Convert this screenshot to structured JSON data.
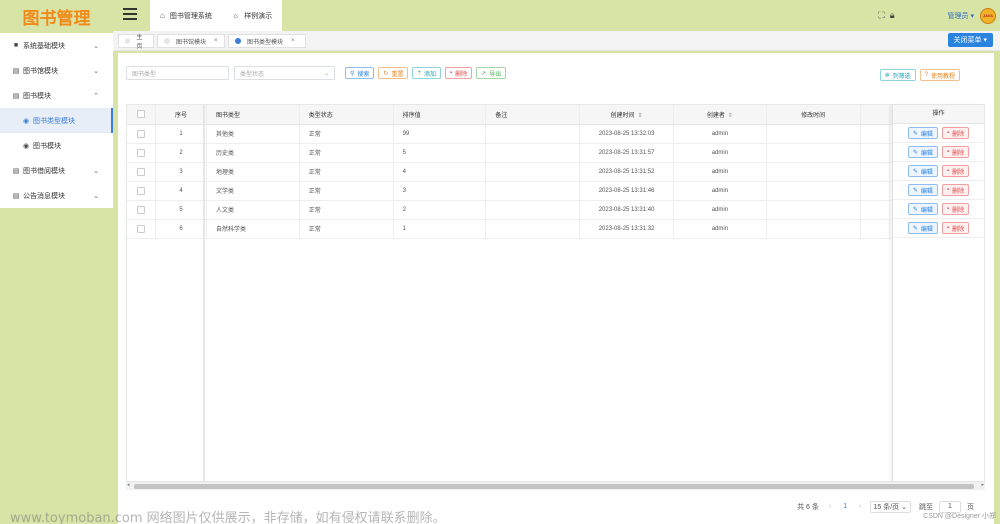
{
  "logo": "图书管理",
  "sidebar": {
    "items": [
      {
        "icon": "■",
        "label": "系统基础模块",
        "arrow": "⌄"
      },
      {
        "icon": "▤",
        "label": "图书馆模块",
        "arrow": "⌄"
      },
      {
        "icon": "▤",
        "label": "图书模块",
        "arrow": "⌃"
      },
      {
        "icon": "◉",
        "label": "图书类型模块",
        "arrow": ""
      },
      {
        "icon": "◉",
        "label": "图书模块",
        "arrow": ""
      },
      {
        "icon": "▤",
        "label": "图书借阅模块",
        "arrow": "⌄"
      },
      {
        "icon": "▤",
        "label": "公告消息模块",
        "arrow": "⌄"
      }
    ]
  },
  "header": {
    "tab_home": "图书管理系统",
    "tab_demo": "样例演示",
    "admin": "管理员",
    "avatar_text": "JAVA"
  },
  "tags": {
    "home": "主页",
    "tag1": "图书馆模块",
    "tag2": "图书类型模块",
    "close_menu": "关闭菜单"
  },
  "toolbar": {
    "type_placeholder": "图书类型",
    "status_placeholder": "类型状态",
    "search": "搜索",
    "reset": "重置",
    "add": "添加",
    "delete": "删除",
    "export": "导出",
    "filter_columns": "列筛选",
    "tutorial": "使用教程"
  },
  "table": {
    "headers": [
      "序号",
      "图书类型",
      "类型状态",
      "排序值",
      "备注",
      "创建时间",
      "创建者",
      "修改时间",
      "操作"
    ],
    "rows": [
      {
        "no": "1",
        "type": "其他类",
        "status": "正常",
        "sort": "99",
        "note": "",
        "created": "2023-08-25 13:32:03",
        "creator": "admin",
        "modified": ""
      },
      {
        "no": "2",
        "type": "历史类",
        "status": "正常",
        "sort": "5",
        "note": "",
        "created": "2023-08-25 13:31:57",
        "creator": "admin",
        "modified": ""
      },
      {
        "no": "3",
        "type": "地理类",
        "status": "正常",
        "sort": "4",
        "note": "",
        "created": "2023-08-25 13:31:52",
        "creator": "admin",
        "modified": ""
      },
      {
        "no": "4",
        "type": "文学类",
        "status": "正常",
        "sort": "3",
        "note": "",
        "created": "2023-08-25 13:31:46",
        "creator": "admin",
        "modified": ""
      },
      {
        "no": "5",
        "type": "人文类",
        "status": "正常",
        "sort": "2",
        "note": "",
        "created": "2023-08-25 13:31:40",
        "creator": "admin",
        "modified": ""
      },
      {
        "no": "6",
        "type": "自然科学类",
        "status": "正常",
        "sort": "1",
        "note": "",
        "created": "2023-08-25 13:31:32",
        "creator": "admin",
        "modified": ""
      }
    ],
    "edit": "编辑",
    "del": "删除"
  },
  "pager": {
    "total": "共 6 条",
    "current": "1",
    "page_size": "15 条/页",
    "goto": "跳至",
    "goto_value": "1",
    "page_unit": "页"
  },
  "watermark": "www.toymoban.com 网络图片仅供展示，非存储，如有侵权请联系删除。",
  "csdn": "CSDN @Designer 小郑"
}
